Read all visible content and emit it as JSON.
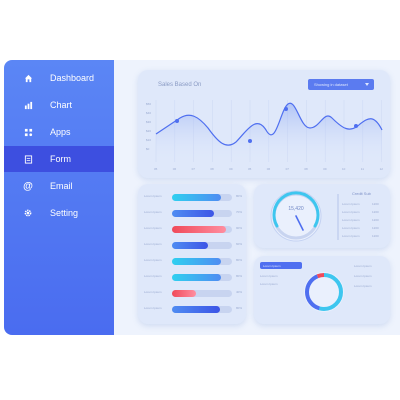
{
  "sidebar": {
    "items": [
      {
        "label": "Dashboard",
        "icon": "home-icon"
      },
      {
        "label": "Chart",
        "icon": "chart-icon"
      },
      {
        "label": "Apps",
        "icon": "apps-icon"
      },
      {
        "label": "Form",
        "icon": "form-icon",
        "active": true
      },
      {
        "label": "Email",
        "icon": "at-icon"
      },
      {
        "label": "Setting",
        "icon": "gear-icon"
      }
    ]
  },
  "sales": {
    "title": "Sales Based On",
    "dropdown": "Showing in dataset",
    "y_ticks": [
      "$50",
      "$40",
      "$30",
      "$20",
      "$10",
      "$0"
    ],
    "x_ticks": [
      "05",
      "06",
      "07",
      "08",
      "09",
      "05",
      "06",
      "07",
      "08",
      "09",
      "10",
      "11",
      "12"
    ]
  },
  "bars": {
    "rows": [
      {
        "label": "Lorem Ipsum",
        "value": "80%",
        "fill": 0.82,
        "color": "cyan"
      },
      {
        "label": "Lorem Ipsum",
        "value": "70%",
        "fill": 0.7,
        "color": "blue"
      },
      {
        "label": "Lorem Ipsum",
        "value": "90%",
        "fill": 0.9,
        "color": "red"
      },
      {
        "label": "Lorem Ipsum",
        "value": "60%",
        "fill": 0.6,
        "color": "blue"
      },
      {
        "label": "Lorem Ipsum",
        "value": "80%",
        "fill": 0.82,
        "color": "cyan"
      },
      {
        "label": "Lorem Ipsum",
        "value": "80%",
        "fill": 0.82,
        "color": "cyan"
      },
      {
        "label": "Lorem Ipsum",
        "value": "40%",
        "fill": 0.4,
        "color": "red"
      },
      {
        "label": "Lorem Ipsum",
        "value": "80%",
        "fill": 0.8,
        "color": "blue"
      }
    ]
  },
  "gauge": {
    "value": "15,420",
    "list_title": "Credit Sub",
    "list": [
      "Lorem Ipsum",
      "Lorem Ipsum",
      "Lorem Ipsum",
      "Lorem Ipsum",
      "Lorem Ipsum"
    ],
    "list_values": [
      "1200",
      "1200",
      "1200",
      "1200",
      "1200"
    ],
    "level": 0.55
  },
  "donut": {
    "tag": "Lorem Ipsum",
    "left_items": [
      "Lorem Ipsum",
      "Lorem Ipsum"
    ],
    "right_items": [
      "Lorem Ipsum",
      "Lorem Ipsum",
      "Lorem Ipsum"
    ]
  },
  "colors": {
    "sidebar": "#4a6cf0",
    "active": "#3d4fe0",
    "accent_blue": "#4f6ff0",
    "accent_cyan": "#2fd0f0",
    "accent_red": "#f04a5a"
  }
}
